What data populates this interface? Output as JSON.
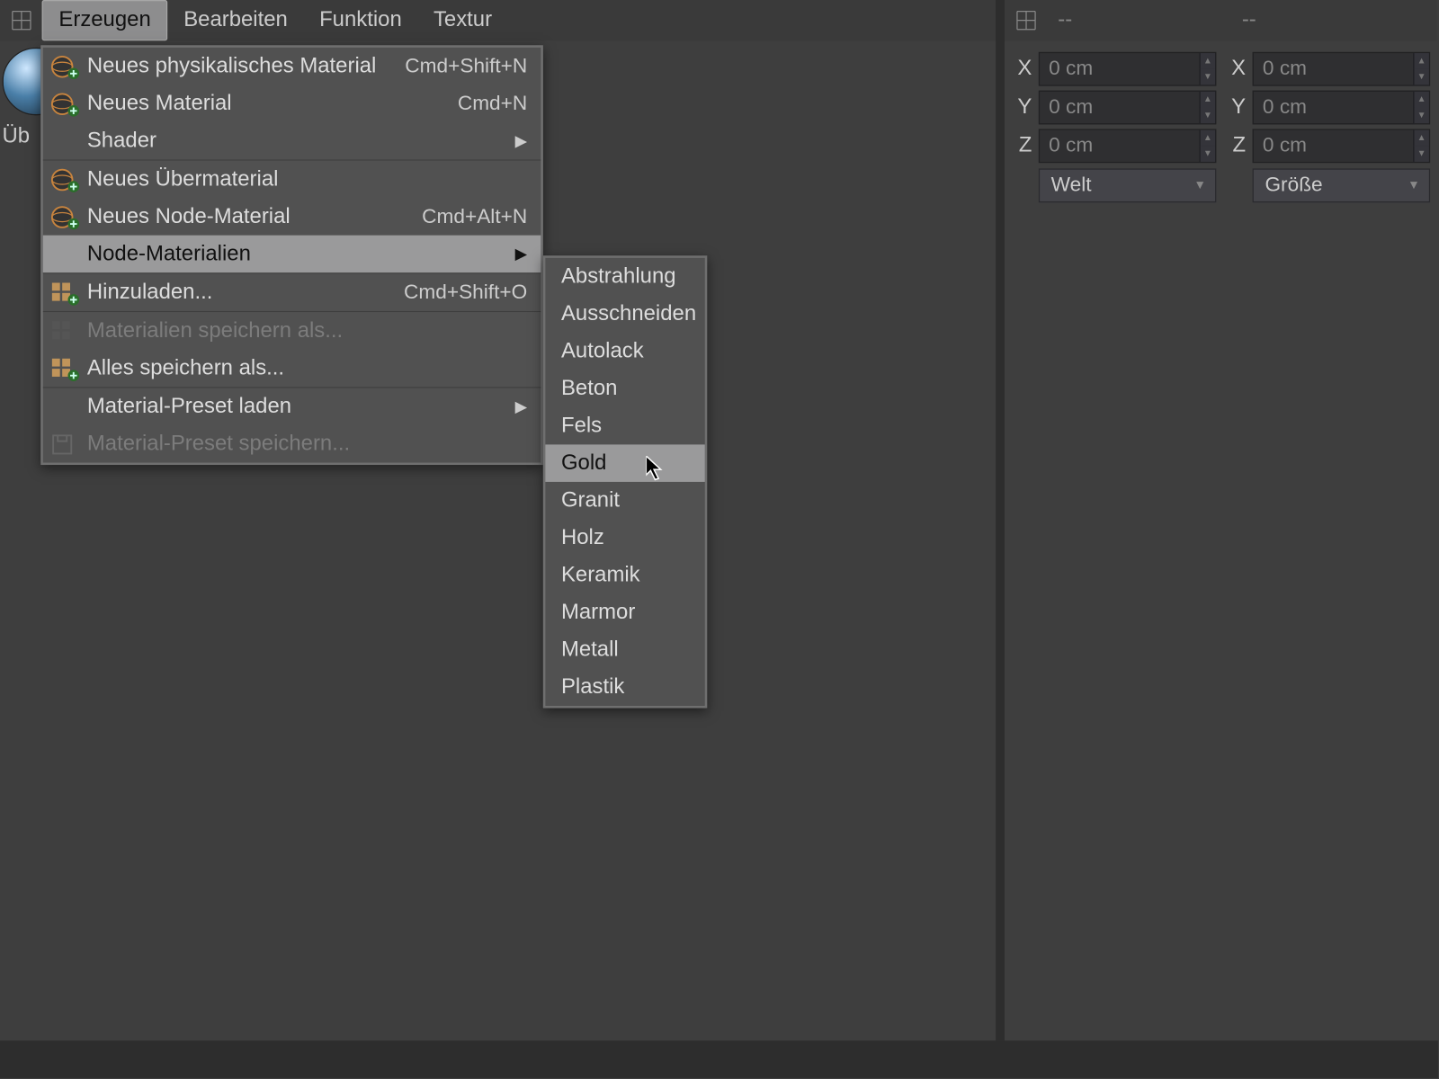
{
  "left_panel": {
    "menubar": {
      "items": [
        "Erzeugen",
        "Bearbeiten",
        "Funktion",
        "Textur"
      ],
      "active_index": 0
    },
    "material_thumb_label": "Üb"
  },
  "right_panel": {
    "menubar": {
      "dash1": "--",
      "dash2": "--"
    },
    "coords": {
      "left": {
        "x_label": "X",
        "x_val": "0 cm",
        "y_label": "Y",
        "y_val": "0 cm",
        "z_label": "Z",
        "z_val": "0 cm"
      },
      "right": {
        "x_label": "X",
        "x_val": "0 cm",
        "y_label": "Y",
        "y_val": "0 cm",
        "z_label": "Z",
        "z_val": "0 cm"
      },
      "mode_left": "Welt",
      "mode_right": "Größe"
    }
  },
  "menu": {
    "groups": [
      [
        {
          "label": "Neues physikalisches Material",
          "shortcut": "Cmd+Shift+N",
          "icon": "sphere-plus"
        },
        {
          "label": "Neues Material",
          "shortcut": "Cmd+N",
          "icon": "sphere-plus"
        },
        {
          "label": "Shader",
          "shortcut": "",
          "icon": "",
          "submenu": true
        }
      ],
      [
        {
          "label": "Neues Übermaterial",
          "shortcut": "",
          "icon": "sphere-plus"
        },
        {
          "label": "Neues Node-Material",
          "shortcut": "Cmd+Alt+N",
          "icon": "sphere-plus"
        },
        {
          "label": "Node-Materialien",
          "shortcut": "",
          "icon": "",
          "submenu": true,
          "hover": true
        }
      ],
      [
        {
          "label": "Hinzuladen...",
          "shortcut": "Cmd+Shift+O",
          "icon": "grid-plus"
        }
      ],
      [
        {
          "label": "Materialien speichern als...",
          "shortcut": "",
          "icon": "grid",
          "disabled": true
        },
        {
          "label": "Alles speichern als...",
          "shortcut": "",
          "icon": "grid-plus"
        }
      ],
      [
        {
          "label": "Material-Preset laden",
          "shortcut": "",
          "icon": "",
          "submenu": true
        },
        {
          "label": "Material-Preset speichern...",
          "shortcut": "",
          "icon": "preset-save",
          "disabled": true
        }
      ]
    ]
  },
  "submenu": {
    "items": [
      {
        "label": "Abstrahlung"
      },
      {
        "label": "Ausschneiden"
      },
      {
        "label": "Autolack"
      },
      {
        "label": "Beton"
      },
      {
        "label": "Fels"
      },
      {
        "label": "Gold",
        "hover": true
      },
      {
        "label": "Granit"
      },
      {
        "label": "Holz"
      },
      {
        "label": "Keramik"
      },
      {
        "label": "Marmor"
      },
      {
        "label": "Metall"
      },
      {
        "label": "Plastik"
      }
    ]
  }
}
